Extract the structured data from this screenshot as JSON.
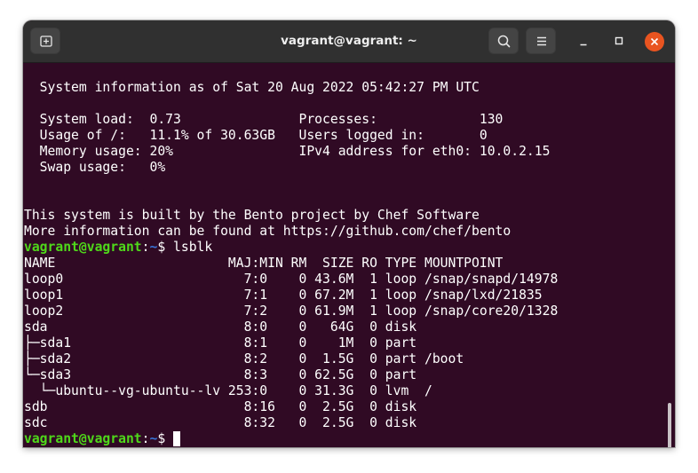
{
  "window": {
    "title": "vagrant@vagrant: ~"
  },
  "titlebar": {
    "new_tab_icon": "new-tab-icon",
    "search_icon": "search-icon",
    "menu_icon": "hamburger-menu-icon",
    "minimize_icon": "minimize-icon",
    "maximize_icon": "maximize-icon",
    "close_icon": "close-icon",
    "close_color": "#e95420"
  },
  "terminal": {
    "background": "#300a24",
    "prompt_user_color": "#4fd91a",
    "prompt_path_color": "#3874d7",
    "sysinfo": [
      "  System information as of Sat 20 Aug 2022 05:42:27 PM UTC",
      "  System load:  0.73               Processes:             130",
      "  Usage of /:   11.1% of 30.63GB   Users logged in:       0",
      "  Memory usage: 20%                IPv4 address for eth0: 10.0.2.15",
      "  Swap usage:   0%"
    ],
    "motd": [
      "This system is built by the Bento project by Chef Software",
      "More information can be found at https://github.com/chef/bento"
    ],
    "prompt": {
      "user_host": "vagrant@vagrant",
      "separator": ":",
      "path": "~",
      "symbol": "$ "
    },
    "command": "lsblk",
    "lsblk_output": [
      "NAME                      MAJ:MIN RM  SIZE RO TYPE MOUNTPOINT",
      "loop0                       7:0    0 43.6M  1 loop /snap/snapd/14978",
      "loop1                       7:1    0 67.2M  1 loop /snap/lxd/21835",
      "loop2                       7:2    0 61.9M  1 loop /snap/core20/1328",
      "sda                         8:0    0   64G  0 disk",
      "├─sda1                      8:1    0    1M  0 part",
      "├─sda2                      8:2    0  1.5G  0 part /boot",
      "└─sda3                      8:3    0 62.5G  0 part",
      "  └─ubuntu--vg-ubuntu--lv 253:0    0 31.3G  0 lvm  /",
      "sdb                         8:16   0  2.5G  0 disk",
      "sdc                         8:32   0  2.5G  0 disk"
    ]
  }
}
